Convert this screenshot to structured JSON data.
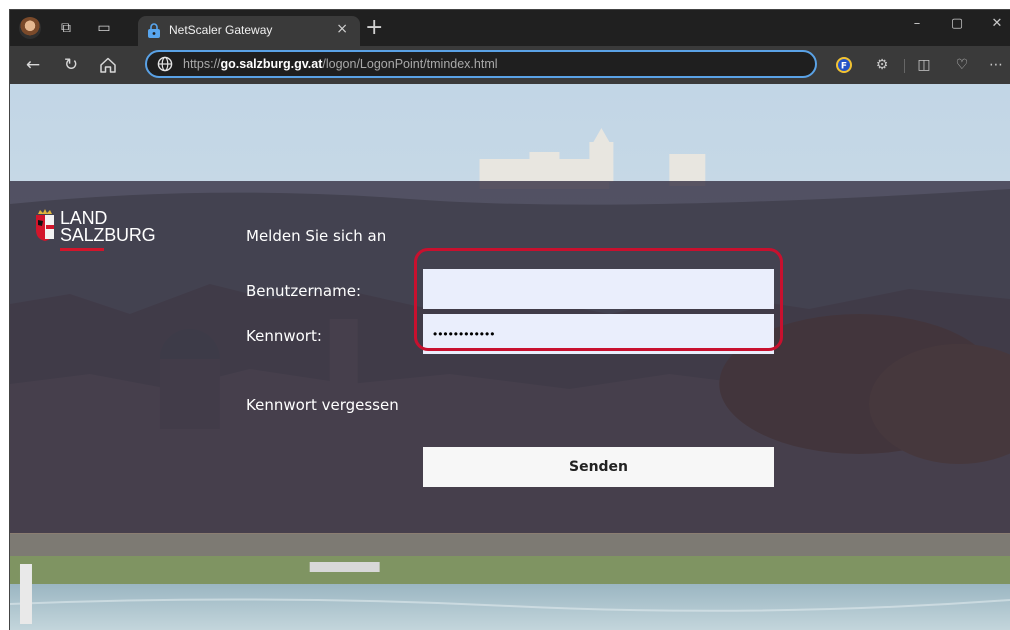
{
  "browser": {
    "tab": {
      "title": "NetScaler Gateway",
      "close_glyph": "×"
    },
    "new_tab_glyph": "+",
    "window_controls": {
      "minimize": "–",
      "maximize": "▢",
      "close": "✕"
    },
    "address": {
      "scheme": "https://",
      "host": "go.salzburg.gv.at",
      "path": "/logon/LogonPoint/tmindex.html"
    },
    "icons": [
      "profile-avatar-icon",
      "collections-icon",
      "tab-actions-icon",
      "lock-icon",
      "back-arrow-icon",
      "refresh-icon",
      "home-icon",
      "globe-icon",
      "extension-f-icon",
      "puzzle-icon",
      "split-screen-icon",
      "browser-essentials-icon",
      "more-menu-icon"
    ]
  },
  "page": {
    "logo": {
      "line1": "LAND",
      "line2": "SALZBURG",
      "accent_color": "#d3152b"
    },
    "form": {
      "title": "Melden Sie sich an",
      "username_label": "Benutzername:",
      "username_value": "",
      "password_label": "Kennwort:",
      "password_value": "••••••••••••",
      "forgot_link": "Kennwort vergessen",
      "submit_label": "Senden"
    },
    "highlight_color": "#c8102e"
  }
}
